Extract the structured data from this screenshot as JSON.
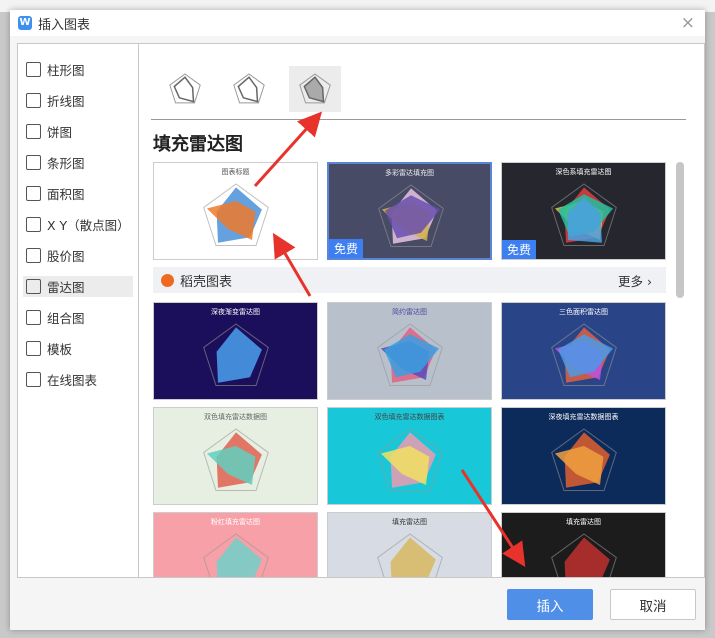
{
  "dialog": {
    "title": "插入图表",
    "close": "×"
  },
  "sidebar": {
    "items": [
      {
        "label": "柱形图"
      },
      {
        "label": "折线图"
      },
      {
        "label": "饼图"
      },
      {
        "label": "条形图"
      },
      {
        "label": "面积图"
      },
      {
        "label": "X Y（散点图）"
      },
      {
        "label": "股价图"
      },
      {
        "label": "雷达图",
        "selected": true
      },
      {
        "label": "组合图"
      },
      {
        "label": "模板"
      },
      {
        "label": "在线图表"
      }
    ]
  },
  "main": {
    "radar_types": [
      "radar",
      "radar-marker",
      "radar-filled"
    ],
    "heading": "填充雷达图",
    "free_badge": "免费",
    "top_templates": [
      {
        "title": "图表标题",
        "bg": "#ffffff",
        "fg": "#555",
        "colors": [
          "#4a90d9",
          "#ee7a2b"
        ]
      },
      {
        "title": "多彩雷达填充图",
        "bg": "#474b66",
        "fg": "#eee",
        "colors": [
          "#e8c6e0",
          "#d4b14a",
          "#6a4fb0"
        ],
        "free": true,
        "selected": true
      },
      {
        "title": "深色系填充雷达图",
        "bg": "#26262e",
        "fg": "#fff",
        "colors": [
          "#e04040",
          "#f0c040",
          "#20c0a0",
          "#4aa0e0"
        ],
        "free": true
      }
    ],
    "category": {
      "label": "稻壳图表",
      "more": "更多"
    },
    "templates": [
      {
        "title": "深夜渐变雷达图",
        "bg": "#1b0f5c",
        "fg": "#fff",
        "colors": [
          "#4aa0ee"
        ]
      },
      {
        "title": "简约雷达图",
        "bg": "#b8c0cc",
        "fg": "#4a4aa0",
        "colors": [
          "#e06080",
          "#5a4ab8",
          "#3aa0e0"
        ]
      },
      {
        "title": "三色面积雷达图",
        "bg": "#2a4488",
        "fg": "#fff",
        "colors": [
          "#e06040",
          "#c050e0",
          "#4a9ae8"
        ]
      },
      {
        "title": "双色填充雷达数据图",
        "bg": "#e6efe2",
        "fg": "#666",
        "colors": [
          "#e06050",
          "#60d0c0"
        ]
      },
      {
        "title": "双色填充雷达数据图表",
        "bg": "#19c8d8",
        "fg": "#444",
        "colors": [
          "#f09ab0",
          "#f0e060"
        ]
      },
      {
        "title": "深夜填充雷达数据图表",
        "bg": "#0c2a5a",
        "fg": "#fff",
        "colors": [
          "#e06030",
          "#f0a040"
        ]
      },
      {
        "title": "粉红填充雷达图",
        "bg": "#f8a0a8",
        "fg": "#fff",
        "colors": [
          "#70d0c8"
        ]
      },
      {
        "title": "填充雷达图",
        "bg": "#d7dce4",
        "fg": "#333",
        "colors": [
          "#d8b860"
        ]
      },
      {
        "title": "填充雷达图",
        "bg": "#1c1c1c",
        "fg": "#fff",
        "colors": [
          "#c03030"
        ]
      }
    ]
  },
  "footer": {
    "insert": "插入",
    "cancel": "取消"
  },
  "accent": "#4f8fe8"
}
